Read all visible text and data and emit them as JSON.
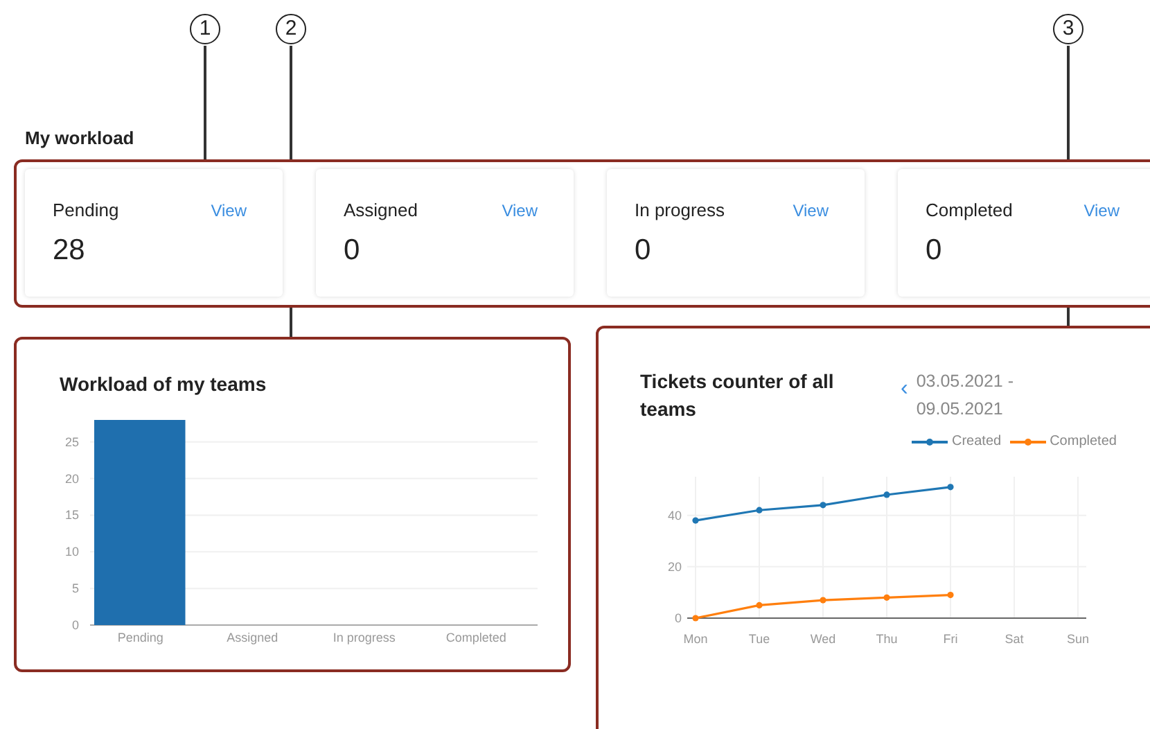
{
  "callouts": [
    "1",
    "2",
    "3"
  ],
  "workload": {
    "title": "My workload",
    "cards": [
      {
        "label": "Pending",
        "link": "View",
        "count": "28"
      },
      {
        "label": "Assigned",
        "link": "View",
        "count": "0"
      },
      {
        "label": "In progress",
        "link": "View",
        "count": "0"
      },
      {
        "label": "Completed",
        "link": "View",
        "count": "0"
      }
    ]
  },
  "team_chart": {
    "title": "Workload of my teams",
    "chart_data": {
      "type": "bar",
      "categories": [
        "Pending",
        "Assigned",
        "In progress",
        "Completed"
      ],
      "values": [
        28,
        0,
        0,
        0
      ],
      "grid": true,
      "ylim": [
        0,
        28
      ],
      "yticks": [
        0,
        5,
        10,
        15,
        20,
        25
      ]
    }
  },
  "tickets_chart": {
    "title": "Tickets counter of all teams",
    "prev": "‹",
    "date_range": "03.05.2021 - 09.05.2021",
    "chart_data": {
      "type": "line",
      "categories": [
        "Mon",
        "Tue",
        "Wed",
        "Thu",
        "Fri",
        "Sat",
        "Sun"
      ],
      "ylim": [
        0,
        55
      ],
      "grid": true,
      "yticks": [
        0,
        20,
        40
      ],
      "series": [
        {
          "name": "Created",
          "color": "#1f77b4",
          "marker": "circle",
          "values": [
            38,
            42,
            44,
            48,
            51,
            null,
            null
          ]
        },
        {
          "name": "Completed",
          "color": "#ff7f0e",
          "marker": "circle",
          "values": [
            0,
            5,
            7,
            8,
            9,
            null,
            null
          ]
        }
      ]
    }
  }
}
